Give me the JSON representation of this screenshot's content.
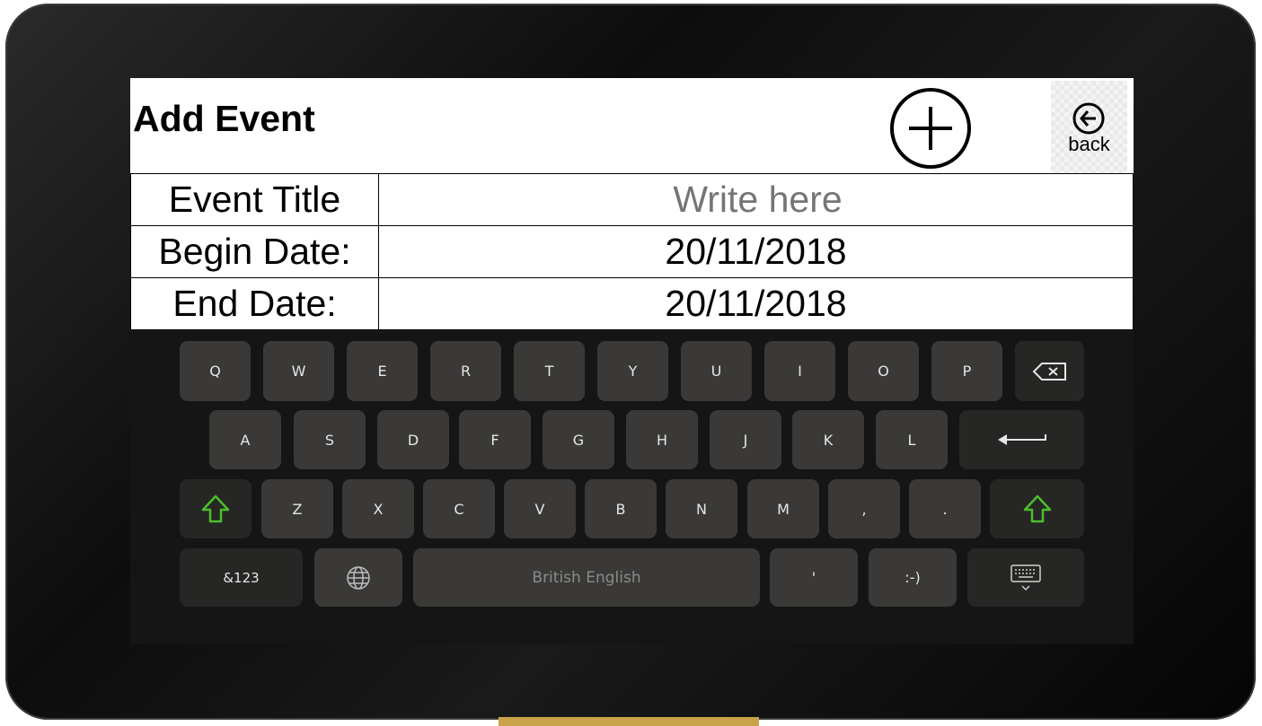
{
  "header": {
    "title": "Add Event",
    "add_icon": "plus-circle-icon",
    "back_label": "back",
    "back_icon": "arrow-left-circle-icon"
  },
  "form": {
    "rows": [
      {
        "label": "Event Title",
        "value": "Write here"
      },
      {
        "label": "Begin Date:",
        "value": "20/11/2018"
      },
      {
        "label": "End Date:",
        "value": "20/11/2018"
      }
    ]
  },
  "keyboard": {
    "row1": [
      "Q",
      "W",
      "E",
      "R",
      "T",
      "Y",
      "U",
      "I",
      "O",
      "P"
    ],
    "row2": [
      "A",
      "S",
      "D",
      "F",
      "G",
      "H",
      "J",
      "K",
      "L"
    ],
    "row3": [
      "Z",
      "X",
      "C",
      "V",
      "B",
      "N",
      "M",
      ",",
      "."
    ],
    "numbers_label": "&123",
    "space_label": "British English",
    "apostrophe": "'",
    "smiley": ":-)",
    "icons": {
      "backspace": "backspace-icon",
      "enter": "enter-icon",
      "shift": "shift-icon",
      "globe": "globe-icon",
      "hide": "keyboard-hide-icon"
    },
    "colors": {
      "key": "#3a3937",
      "special_key": "#262625",
      "shift": "#4cbf2a",
      "background": "#151515"
    }
  }
}
